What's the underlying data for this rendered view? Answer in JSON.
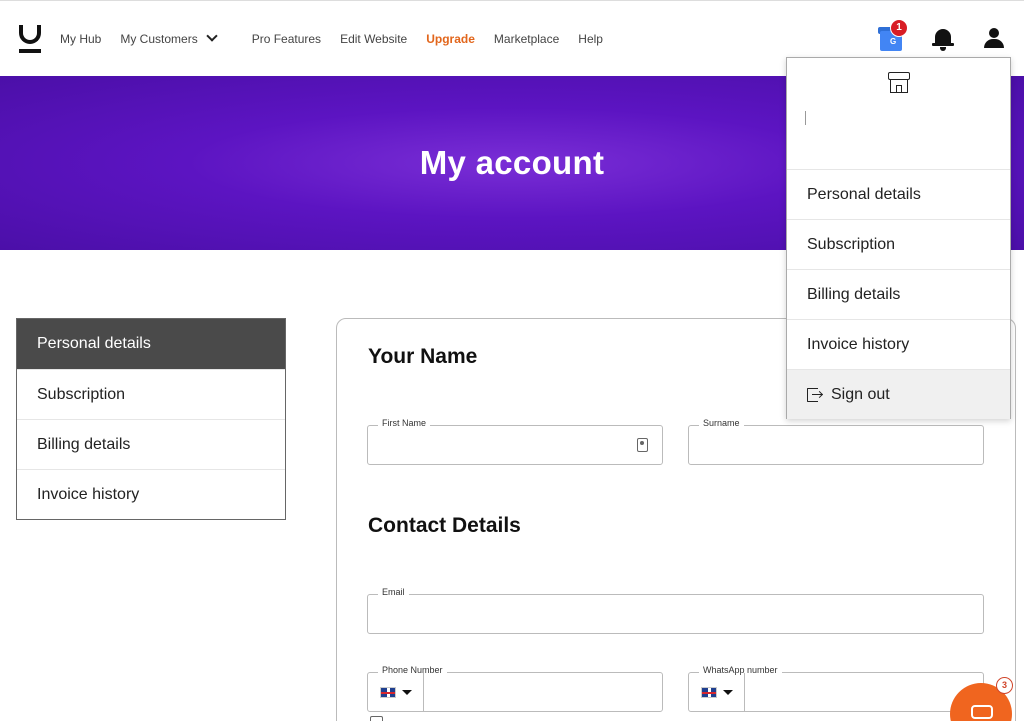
{
  "nav": {
    "links": [
      "My Hub",
      "My Customers",
      "Pro Features",
      "Edit Website",
      "Upgrade",
      "Marketplace",
      "Help"
    ],
    "gmb_badge": "1",
    "gmb_letter": "G",
    "accent_upgrade": "#e2661c"
  },
  "hero": {
    "title": "My account",
    "color": "#5c14c2"
  },
  "sidemenu": {
    "items": [
      "Personal details",
      "Subscription",
      "Billing details",
      "Invoice history"
    ],
    "active": "Personal details"
  },
  "form": {
    "name_heading": "Your Name",
    "first_name_label": "First Name",
    "surname_label": "Surname",
    "contact_heading": "Contact Details",
    "email_label": "Email",
    "phone_label": "Phone Number",
    "whatsapp_label": "WhatsApp number"
  },
  "dropdown": {
    "items": [
      "Personal details",
      "Subscription",
      "Billing details",
      "Invoice history"
    ],
    "signout": "Sign out"
  },
  "chat": {
    "badge": "3",
    "color": "#f0651f"
  }
}
